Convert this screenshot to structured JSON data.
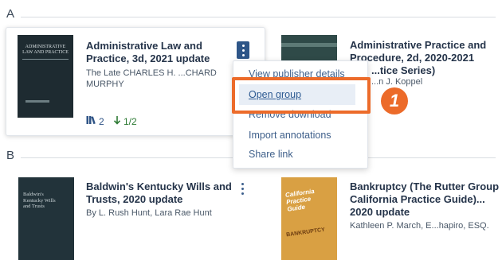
{
  "sections": {
    "a_label": "A",
    "b_label": "B"
  },
  "books": {
    "admin_law": {
      "title_line1": "Administrative Law and",
      "title_line2": "Practice, 3d, 2021 update",
      "author_line1": "The Late CHARLES H. ...CHARD",
      "author_line2": "MURPHY",
      "cover_title": "ADMINISTRATIVE LAW AND PRACTICE",
      "count": "2",
      "fraction": "1/2"
    },
    "admin_practice": {
      "title_line1": "Administrative Practice and",
      "title_line2": "Procedure, 2d, 2020-2021",
      "title_line3": "...tice Series)",
      "author": "...n J. Koppel"
    },
    "baldwins": {
      "title_line1": "Baldwin's Kentucky Wills and",
      "title_line2": "Trusts, 2020 update",
      "author": "By L. Rush Hunt, Lara Rae Hunt",
      "cover_title": "Baldwin's Kentucky Wills and Trusts"
    },
    "bankruptcy": {
      "title_line1": "Bankruptcy (The Rutter Group",
      "title_line2": "California Practice Guide)...",
      "title_line3": "2020 update",
      "author": "Kathleen P. March, E...hapiro, ESQ.",
      "cover_title": "California Practice Guide",
      "cover_subtitle": "BANKRUPTCY"
    }
  },
  "menu": {
    "items": [
      "View publisher details",
      "Open group",
      "Remove download",
      "Import annotations",
      "Share link"
    ]
  },
  "callout": {
    "number": "1",
    "color": "#ec6b2a"
  }
}
